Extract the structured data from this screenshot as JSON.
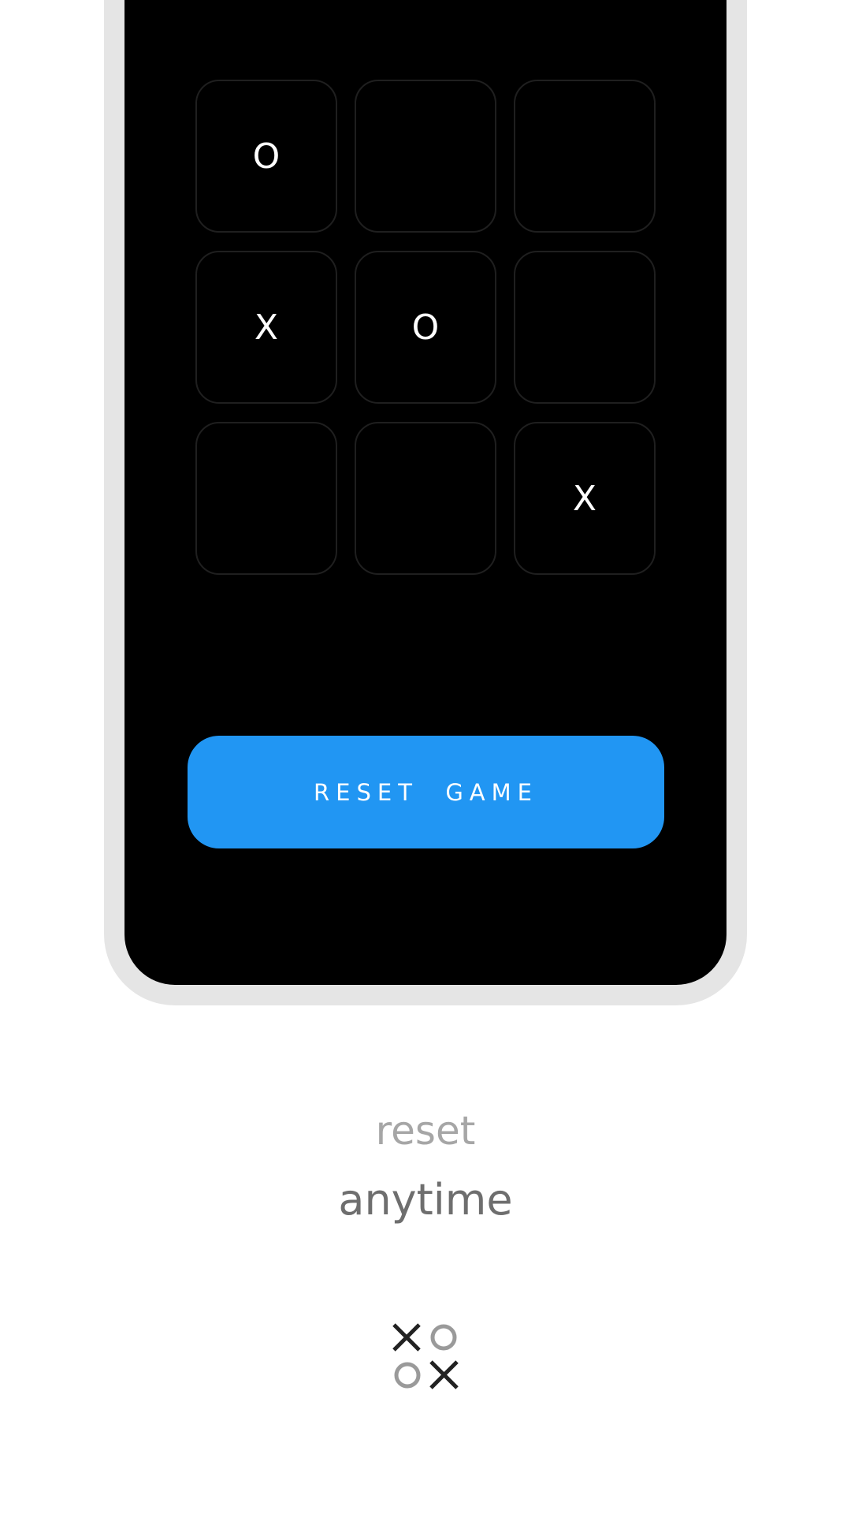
{
  "board": {
    "cells": [
      "O",
      "",
      "",
      "X",
      "O",
      "",
      "",
      "",
      "X"
    ]
  },
  "reset_button": {
    "label": "RESET  GAME"
  },
  "tagline": {
    "line1": "reset",
    "line2": "anytime"
  },
  "logo": {
    "icon": "tic-tac-toe-logo-icon"
  },
  "colors": {
    "screen": "#000000",
    "frame": "#e5e5e5",
    "accent": "#2196f3",
    "cell_border": "#1f1f1f",
    "tagline_light": "#a6a6a6",
    "tagline_dark": "#6e6e6e",
    "logo_dark": "#222222",
    "logo_light": "#9a9a9a"
  }
}
